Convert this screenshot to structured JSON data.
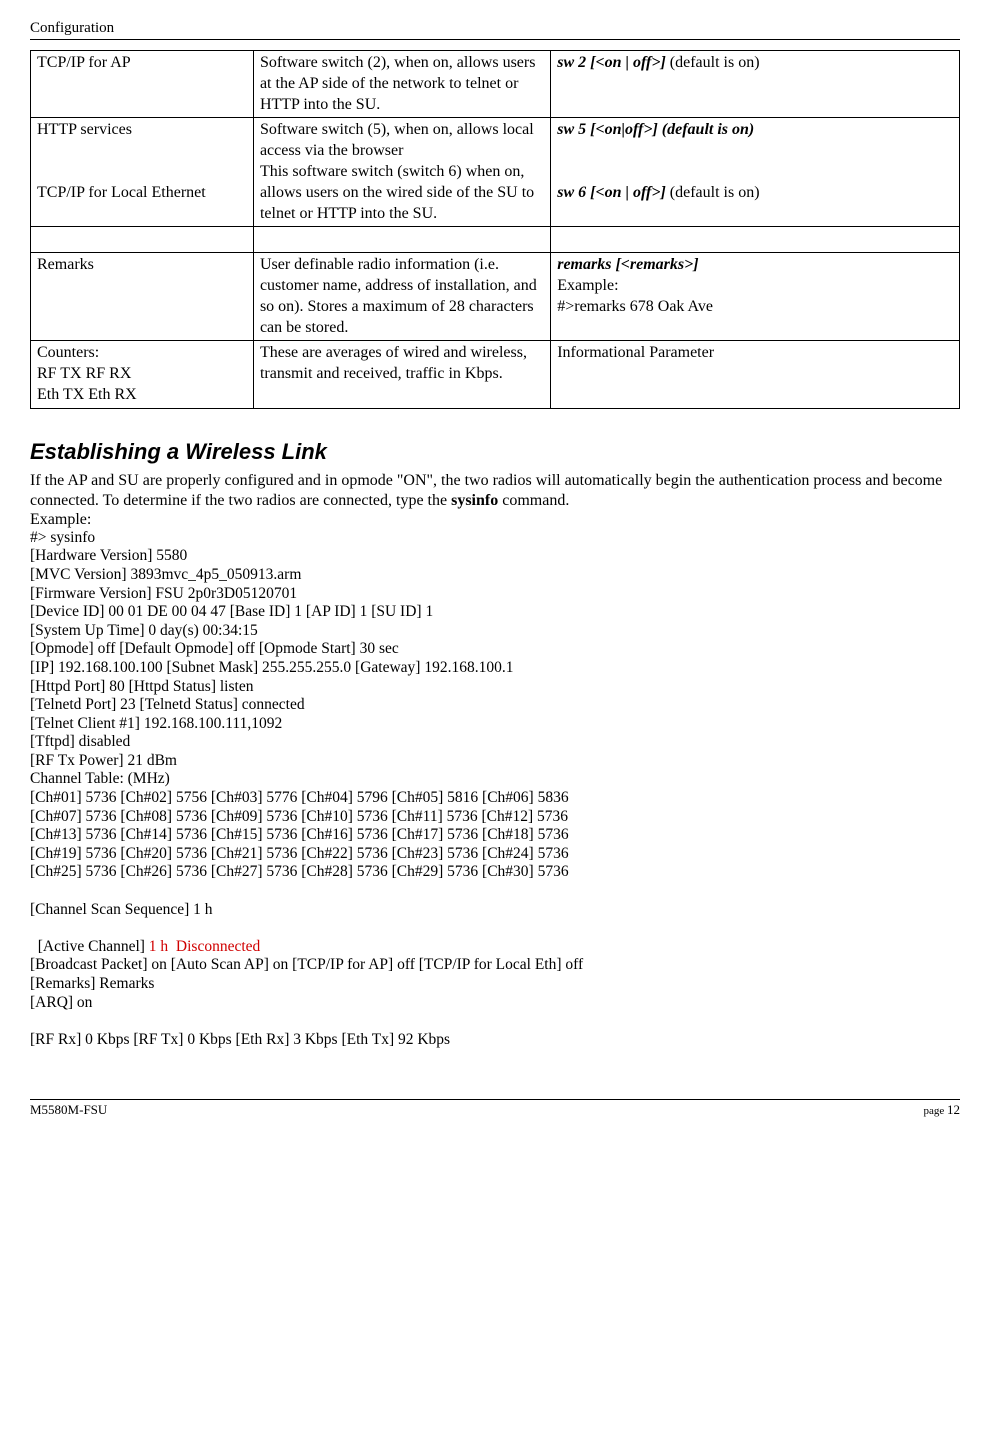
{
  "header": "Configuration",
  "table": {
    "rows": [
      {
        "c1": "TCP/IP for AP",
        "c2": "Software switch (2), when on, allows users at the AP side of the network to telnet or HTTP into the SU.",
        "c3_bold": "sw 2 [<on | off>]",
        "c3_rest": " (default is on)"
      },
      {
        "c1a": "HTTP services",
        "c1b": "TCP/IP for Local Ethernet",
        "c2a": "Software switch (5),  when on, allows local access via the browser",
        "c2b": "This software switch (switch 6) when on, allows users on the wired side of the SU to telnet or HTTP into the SU.",
        "c3_bold1": "sw 5 [<on|off>] (default is on)",
        "c3_bold2": "sw 6 [<on | off>]",
        "c3_rest2": " (default is on)"
      },
      {
        "empty": true
      },
      {
        "c1": "Remarks",
        "c2": "User definable radio information (i.e. customer name, address of installation, and so on).  Stores  a maximum of  28 characters can be stored.",
        "c3_bold": "remarks [<remarks>]",
        "c3_line2": "Example:",
        "c3_line3": "#>remarks 678 Oak Ave"
      },
      {
        "c1a": "Counters:",
        "c1b": "RF TX RF RX",
        "c1c": "Eth TX Eth RX",
        "c2": "These are averages of wired and wireless, transmit and received, traffic in Kbps.",
        "c3": "Informational Parameter"
      }
    ]
  },
  "section_title": "Establishing a Wireless Link",
  "intro_p1": "If the AP and SU are properly configured and in opmode \"ON\", the two radios will automatically begin the authentication process and become connected.  To determine if the two radios are connected, type the ",
  "intro_bold": "sysinfo",
  "intro_p2": "  command.",
  "example_label": "Example:",
  "block": [
    "#> sysinfo",
    "[Hardware Version] 5580",
    "[MVC Version] 3893mvc_4p5_050913.arm",
    "[Firmware Version] FSU 2p0r3D05120701",
    "[Device ID] 00 01 DE 00 04 47 [Base ID] 1 [AP ID] 1 [SU ID] 1",
    "[System Up Time] 0 day(s) 00:34:15",
    "[Opmode] off [Default Opmode] off [Opmode Start] 30 sec",
    "[IP] 192.168.100.100 [Subnet Mask] 255.255.255.0 [Gateway] 192.168.100.1",
    "[Httpd Port] 80 [Httpd Status] listen",
    "[Telnetd Port] 23 [Telnetd Status] connected",
    "[Telnet Client #1] 192.168.100.111,1092",
    "[Tftpd] disabled",
    "[RF Tx Power] 21 dBm",
    "Channel Table: (MHz)",
    "[Ch#01] 5736 [Ch#02] 5756 [Ch#03] 5776 [Ch#04] 5796 [Ch#05] 5816 [Ch#06] 5836",
    "[Ch#07] 5736 [Ch#08] 5736 [Ch#09] 5736 [Ch#10] 5736 [Ch#11] 5736 [Ch#12] 5736",
    "[Ch#13] 5736 [Ch#14] 5736 [Ch#15] 5736 [Ch#16] 5736 [Ch#17] 5736 [Ch#18] 5736",
    "[Ch#19] 5736 [Ch#20] 5736 [Ch#21] 5736 [Ch#22] 5736 [Ch#23] 5736 [Ch#24] 5736",
    "[Ch#25] 5736 [Ch#26] 5736 [Ch#27] 5736 [Ch#28] 5736 [Ch#29] 5736 [Ch#30] 5736",
    "",
    "[Channel Scan Sequence] 1 h"
  ],
  "active_channel_label": "[Active Channel] ",
  "active_channel_red": "1 h  Disconnected",
  "block2": [
    "[Broadcast Packet] on [Auto Scan AP] on [TCP/IP for AP] off [TCP/IP for Local Eth] off",
    "[Remarks] Remarks",
    "[ARQ] on",
    "",
    "[RF Rx] 0 Kbps [RF Tx] 0 Kbps [Eth Rx] 3 Kbps [Eth Tx] 92 Kbps"
  ],
  "footer_left": "M5580M-FSU",
  "footer_right_label": "page ",
  "footer_right_num": "12"
}
